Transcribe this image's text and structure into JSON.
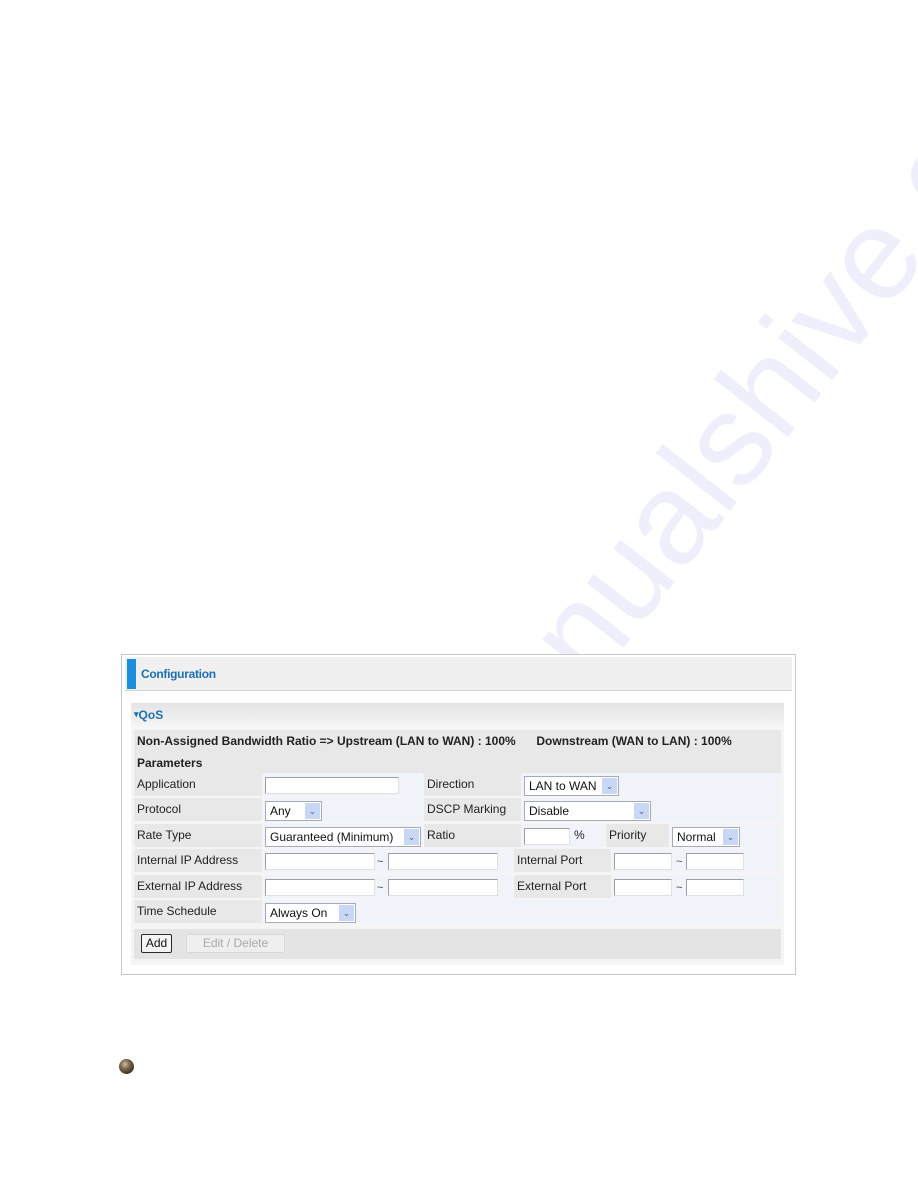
{
  "watermark": "manualshive.com",
  "panel": {
    "title": "Configuration",
    "section": "QoS",
    "bandwidth_info": {
      "upstream": "Non-Assigned Bandwidth Ratio => Upstream (LAN to WAN) : 100%",
      "downstream": "Downstream (WAN to LAN) : 100%"
    },
    "parameters_label": "Parameters",
    "fields": {
      "application": {
        "label": "Application",
        "value": ""
      },
      "direction": {
        "label": "Direction",
        "selected": "LAN to WAN"
      },
      "protocol": {
        "label": "Protocol",
        "selected": "Any"
      },
      "dscp_marking": {
        "label": "DSCP Marking",
        "selected": "Disable"
      },
      "rate_type": {
        "label": "Rate Type",
        "selected": "Guaranteed (Minimum)"
      },
      "ratio": {
        "label": "Ratio",
        "value": "",
        "unit": "%"
      },
      "priority": {
        "label": "Priority",
        "selected": "Normal"
      },
      "internal_ip": {
        "label": "Internal IP Address",
        "from": "",
        "to": "",
        "separator": "~"
      },
      "internal_port": {
        "label": "Internal Port",
        "from": "",
        "to": "",
        "separator": "~"
      },
      "external_ip": {
        "label": "External IP Address",
        "from": "",
        "to": "",
        "separator": "~"
      },
      "external_port": {
        "label": "External Port",
        "from": "",
        "to": "",
        "separator": "~"
      },
      "time_schedule": {
        "label": "Time Schedule",
        "selected": "Always On"
      }
    },
    "buttons": {
      "add": "Add",
      "edit_delete": "Edit / Delete"
    }
  },
  "icons": {
    "dropdown": "⌵",
    "collapse": "▾"
  }
}
